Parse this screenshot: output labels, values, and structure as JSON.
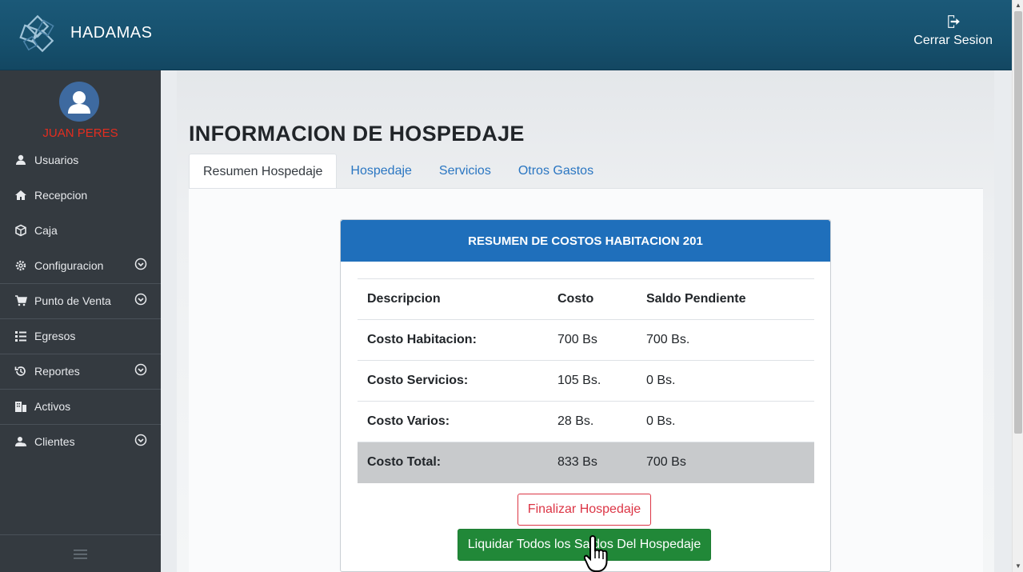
{
  "header": {
    "brand": "HADAMAS",
    "logout_label": "Cerrar Sesion"
  },
  "sidebar": {
    "user_name": "JUAN PERES",
    "items": [
      {
        "label": "Usuarios",
        "icon": "user-icon",
        "expandable": false
      },
      {
        "label": "Recepcion",
        "icon": "home-icon",
        "expandable": false
      },
      {
        "label": "Caja",
        "icon": "cube-icon",
        "expandable": false
      },
      {
        "label": "Configuracion",
        "icon": "gear-icon",
        "expandable": true
      },
      {
        "label": "Punto de Venta",
        "icon": "cart-icon",
        "expandable": true
      },
      {
        "label": "Egresos",
        "icon": "list-icon",
        "expandable": false
      },
      {
        "label": "Reportes",
        "icon": "history-icon",
        "expandable": true
      },
      {
        "label": "Activos",
        "icon": "building-icon",
        "expandable": false
      },
      {
        "label": "Clientes",
        "icon": "users-icon",
        "expandable": true
      }
    ]
  },
  "main": {
    "title": "INFORMACION DE HOSPEDAJE",
    "tabs": [
      {
        "label": "Resumen Hospedaje",
        "active": true
      },
      {
        "label": "Hospedaje",
        "active": false
      },
      {
        "label": "Servicios",
        "active": false
      },
      {
        "label": "Otros Gastos",
        "active": false
      }
    ],
    "card": {
      "header": "RESUMEN DE COSTOS HABITACION 201",
      "columns": [
        "Descripcion",
        "Costo",
        "Saldo Pendiente"
      ],
      "rows": [
        [
          "Costo Habitacion:",
          "700 Bs",
          "700 Bs."
        ],
        [
          "Costo Servicios:",
          "105 Bs.",
          "0 Bs."
        ],
        [
          "Costo Varios:",
          "28 Bs.",
          "0 Bs."
        ]
      ],
      "total": [
        "Costo Total:",
        "833 Bs",
        "700 Bs"
      ],
      "finish_button": "Finalizar Hospedaje",
      "settle_button": "Liquidar Todos los Saldos Del Hospedaje"
    }
  },
  "colors": {
    "header_bg": "#16506d",
    "sidebar_bg": "#343a40",
    "card_header": "#1f6fbb",
    "user_name": "#e32d1f",
    "settle_button": "#218838",
    "finish_button": "#dc3545"
  }
}
